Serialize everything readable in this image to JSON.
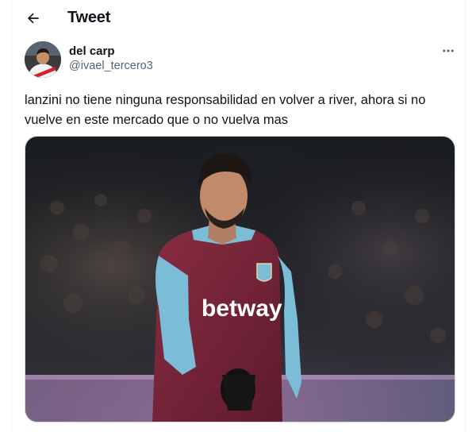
{
  "header": {
    "title": "Tweet",
    "back_icon": "arrow-left-icon"
  },
  "author": {
    "display_name": "del carp",
    "handle": "@ivael_tercero3",
    "avatar_icon": "user-avatar"
  },
  "more_icon": "more-horizontal-icon",
  "tweet": {
    "text_line1": "lanzini no tiene ninguna responsabilidad en volver a river, ahora si no",
    "text_line2": "vuelve en este mercado que o no vuelva mas"
  },
  "media": {
    "kind": "photo",
    "shirt_sponsor": "betway"
  },
  "colors": {
    "text": "#0f1419",
    "secondary_text": "#536471",
    "border": "#eff3f4",
    "claret": "#7a2639",
    "sky_blue": "#7bbcd6"
  }
}
